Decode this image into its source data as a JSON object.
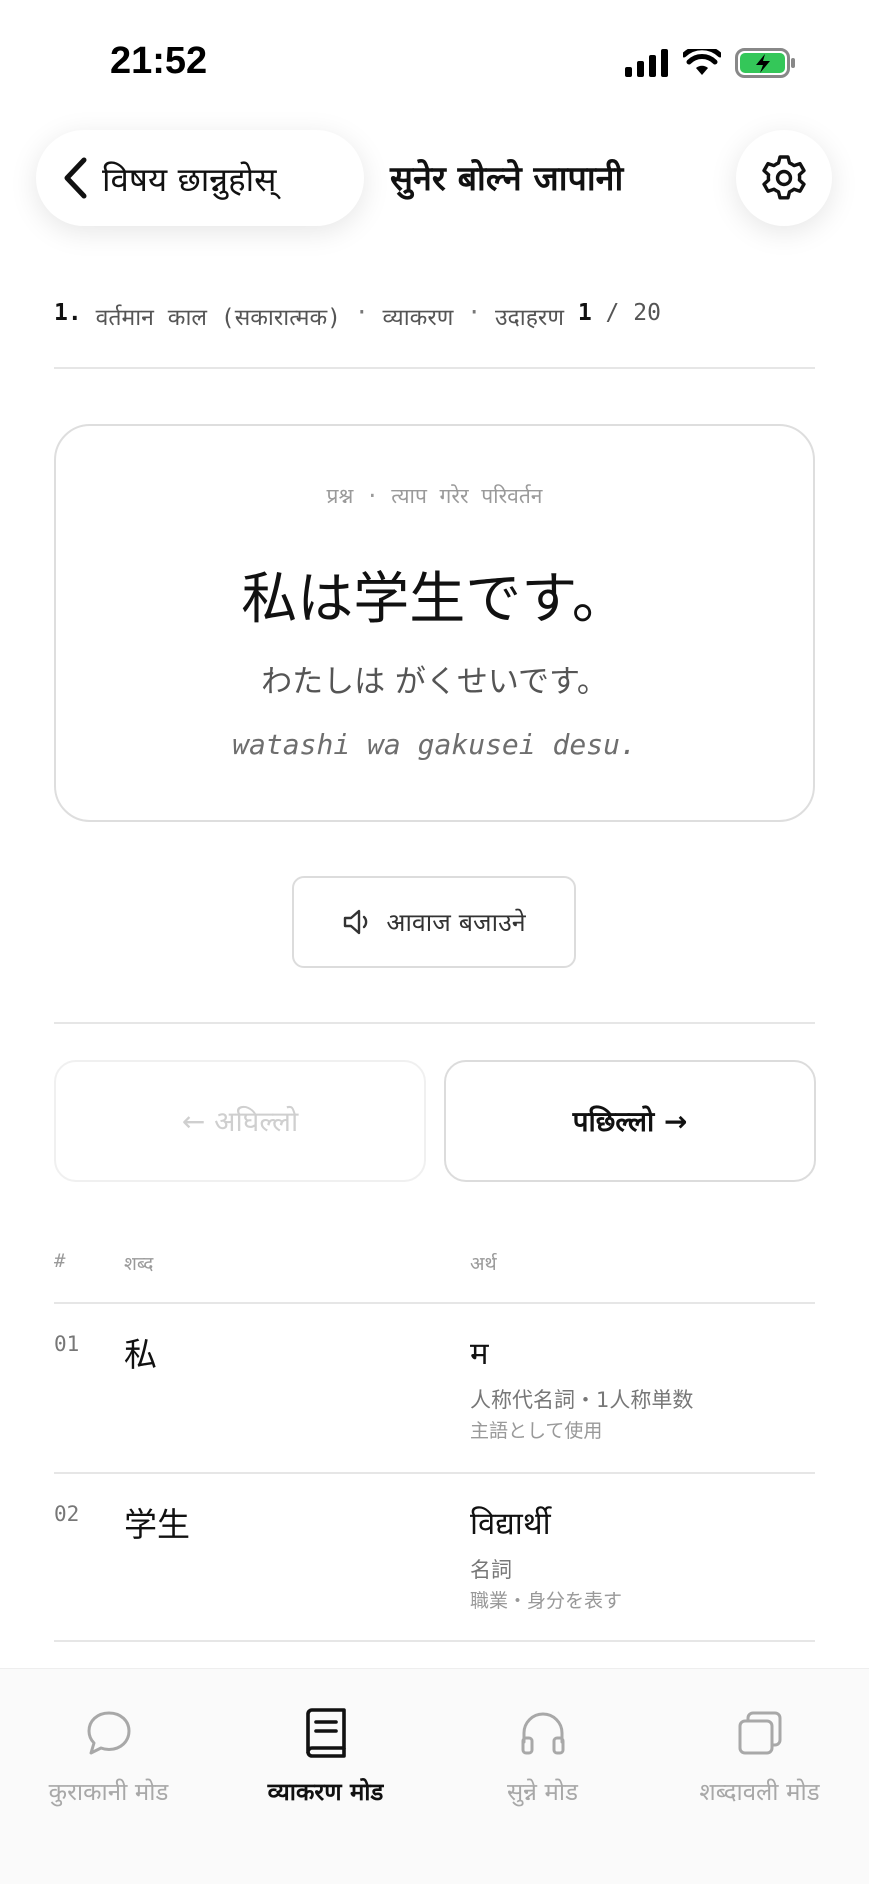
{
  "status": {
    "time": "21:52"
  },
  "header": {
    "back_label": "विषय छान्नुहोस्",
    "title": "सुनेर बोल्ने जापानी"
  },
  "breadcrumb": {
    "index": "1.",
    "lesson": "वर्तमान काल (सकारात्मक)",
    "section": "व्याकरण",
    "example_label": "उदाहरण",
    "current": "1",
    "total": "/ 20"
  },
  "card": {
    "subtitle": "प्रश्न · त्याप गरेर परिवर्तन",
    "sentence": "私は学生です。",
    "kana": "わたしは がくせいです。",
    "romaji": "watashi wa gakusei desu."
  },
  "play": {
    "label": "आवाज बजाउने"
  },
  "nav": {
    "prev_label": "← अघिल्लो",
    "next_label": "पछिल्लो →"
  },
  "table": {
    "headers": {
      "num": "#",
      "word": "शब्द",
      "meaning": "अर्थ"
    },
    "rows": [
      {
        "num": "01",
        "word": "私",
        "meaning": "म",
        "note1": "人称代名詞・1人称単数",
        "note2": "主語として使用"
      },
      {
        "num": "02",
        "word": "学生",
        "meaning": "विद्यार्थी",
        "note1": "名詞",
        "note2": "職業・身分を表す"
      }
    ]
  },
  "tabs": [
    {
      "label": "कुराकानी मोड",
      "icon": "chat-bubble-icon",
      "active": false
    },
    {
      "label": "व्याकरण मोड",
      "icon": "book-icon",
      "active": true
    },
    {
      "label": "सुन्ने मोड",
      "icon": "headphones-icon",
      "active": false
    },
    {
      "label": "शब्दावली मोड",
      "icon": "cards-icon",
      "active": false
    }
  ],
  "colors": {
    "accent": "#111111",
    "muted": "#a8a8a8",
    "battery": "#34c759"
  }
}
